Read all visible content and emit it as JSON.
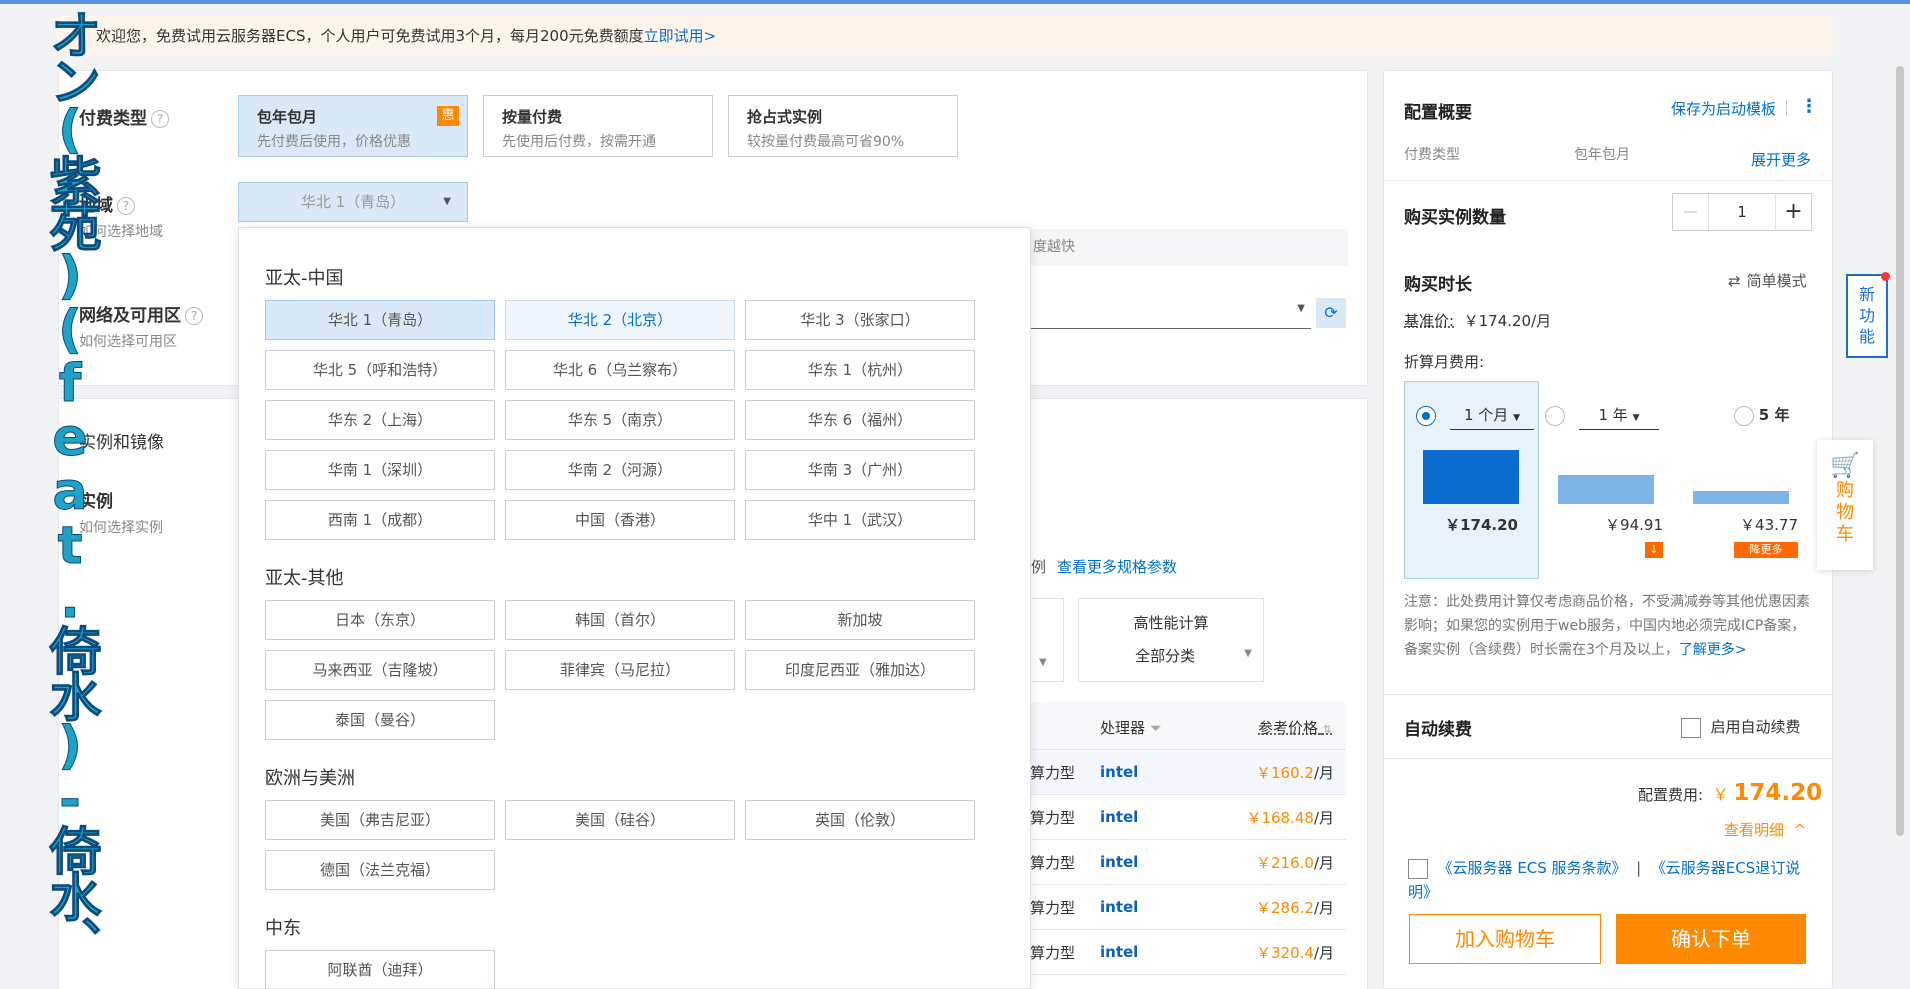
{
  "banner": {
    "text": "欢迎您，免费试用云服务器ECS，个人用户可免费试用3个月，每月200元免费额度",
    "link": "立即试用>"
  },
  "pay": {
    "label": "付费类型",
    "help": "?",
    "cards": [
      {
        "title": "包年包月",
        "desc": "先付费后使用，价格优惠",
        "badge": "惠"
      },
      {
        "title": "按量付费",
        "desc": "先使用后付费，按需开通"
      },
      {
        "title": "抢占式实例",
        "desc": "较按量付费最高可省90%"
      }
    ]
  },
  "region": {
    "label": "地域",
    "help": "?",
    "sub": "如何选择地域",
    "selected": "华北 1（青岛）",
    "hint_tail": "度越快"
  },
  "network": {
    "label": "网络及可用区",
    "help": "?",
    "sub": "如何选择可用区"
  },
  "instance": {
    "section": "实例和镜像",
    "label": "实例",
    "sub": "如何选择实例",
    "more_specs": "查看更多规格参数",
    "example_tail": "例",
    "hpc": "高性能计算",
    "all_cat": "全部分类",
    "proc_header": "处理器",
    "price_header": "参考价格"
  },
  "rows": [
    {
      "type": "算力型",
      "cpu": "intel",
      "price": "￥160.2",
      "unit": "/月"
    },
    {
      "type": "算力型",
      "cpu": "intel",
      "price": "￥168.48",
      "unit": "/月"
    },
    {
      "type": "算力型",
      "cpu": "intel",
      "price": "￥216.0",
      "unit": "/月"
    },
    {
      "type": "算力型",
      "cpu": "intel",
      "price": "￥286.2",
      "unit": "/月"
    },
    {
      "type": "算力型",
      "cpu": "intel",
      "price": "￥320.4",
      "unit": "/月"
    }
  ],
  "dropdown": {
    "groups": [
      {
        "name": "亚太-中国",
        "items": [
          "华北 1（青岛）",
          "华北 2（北京）",
          "华北 3（张家口）",
          "华北 5（呼和浩特）",
          "华北 6（乌兰察布）",
          "华东 1（杭州）",
          "华东 2（上海）",
          "华东 5（南京）",
          "华东 6（福州）",
          "华南 1（深圳）",
          "华南 2（河源）",
          "华南 3（广州）",
          "西南 1（成都）",
          "中国（香港）",
          "华中 1（武汉）"
        ]
      },
      {
        "name": "亚太-其他",
        "items": [
          "日本（东京）",
          "韩国（首尔）",
          "新加坡",
          "马来西亚（吉隆坡）",
          "菲律宾（马尼拉）",
          "印度尼西亚（雅加达）",
          "泰国（曼谷）"
        ]
      },
      {
        "name": "欧洲与美洲",
        "items": [
          "美国（弗吉尼亚）",
          "美国（硅谷）",
          "英国（伦敦）",
          "德国（法兰克福）"
        ]
      },
      {
        "name": "中东",
        "items": [
          "阿联酋（迪拜）"
        ]
      }
    ]
  },
  "summary": {
    "title": "配置概要",
    "save_template": "保存为启动模板",
    "more": "⋮",
    "pay_label": "付费类型",
    "pay_value": "包年包月",
    "expand": "展开更多",
    "qty_label": "购买实例数量",
    "qty_value": "1",
    "minus": "—",
    "plus": "+",
    "duration_label": "购买时长",
    "simple_mode": "简单模式",
    "simple_icon": "⇄",
    "base_price_label": "基准价:",
    "base_price": "￥174.20/月",
    "monthly_label": "折算月费用:",
    "options": [
      {
        "label": "1 个月",
        "price": "￥174.20",
        "selected": true,
        "height_ratio": 1.0,
        "dropdown": true
      },
      {
        "label": "1 年",
        "price": "￥94.91",
        "selected": false,
        "height_ratio": 0.545,
        "dropdown": true,
        "badge": "↓"
      },
      {
        "label": "5 年",
        "price": "￥43.77",
        "selected": false,
        "height_ratio": 0.251,
        "dropdown": false,
        "badge": "降更多"
      }
    ],
    "note": "注意：此处费用计算仅考虑商品价格，不受满减券等其他优惠因素影响；如果您的实例用于web服务，中国内地必须完成ICP备案，备案实例（含续费）时长需在3个月及以上，",
    "note_link": "了解更多>",
    "auto_renew_label": "自动续费",
    "auto_renew_opt": "启用自动续费",
    "fee_label": "配置费用:",
    "fee_currency": "￥",
    "fee_value": "174.20",
    "detail": "查看明细",
    "detail_icon": "^",
    "terms1": "《云服务器 ECS 服务条款》",
    "terms_sep": "|",
    "terms2": "《云服务器ECS退订说明》",
    "add_cart": "加入购物车",
    "confirm": "确认下单"
  },
  "float": {
    "new_feature": "新功能",
    "cart": "购物车"
  },
  "overlay_lyric": "オン(紫苑)(feat.倚水)-倚水、",
  "colors": {
    "accent": "#0070cc",
    "orange": "#ff8a00"
  }
}
